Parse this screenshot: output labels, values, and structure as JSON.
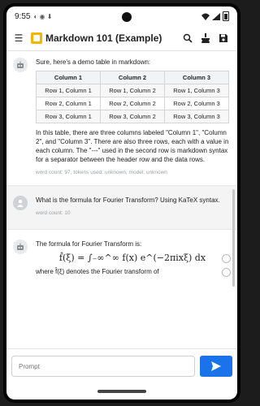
{
  "status_bar": {
    "time": "9:55"
  },
  "app_bar": {
    "title": "Markdown 101 (Example)"
  },
  "messages": {
    "bot1": {
      "intro": "Sure, here's a demo table in markdown:",
      "table": {
        "headers": [
          "Column 1",
          "Column 2",
          "Column 3"
        ],
        "rows": [
          [
            "Row 1, Column 1",
            "Row 1, Column 2",
            "Row 1, Column 3"
          ],
          [
            "Row 2, Column 1",
            "Row 2, Column 2",
            "Row 2, Column 3"
          ],
          [
            "Row 3, Column 1",
            "Row 3, Column 2",
            "Row 3, Column 3"
          ]
        ]
      },
      "explanation": "In this table, there are three columns labeled \"Column 1\", \"Column 2\", and \"Column 3\". There are also three rows, each with a value in each column. The \"---\" used in the second row is markdown syntax for a separator between the header row and the data rows.",
      "meta": "word count: 97, tokens used: unknown, model: unknown"
    },
    "user1": {
      "text": "What is the formula for Fourier Transform? Using KaTeX syntax.",
      "meta": "word count: 10"
    },
    "bot2": {
      "intro": "The formula for Fourier Transform is:",
      "formula": "f̂(ξ) = ∫₋∞^∞ f(x) e^(−2πixξ) dx",
      "after": "where f̂(ξ) denotes the Fourier transform of"
    }
  },
  "input": {
    "placeholder": "Prompt"
  }
}
